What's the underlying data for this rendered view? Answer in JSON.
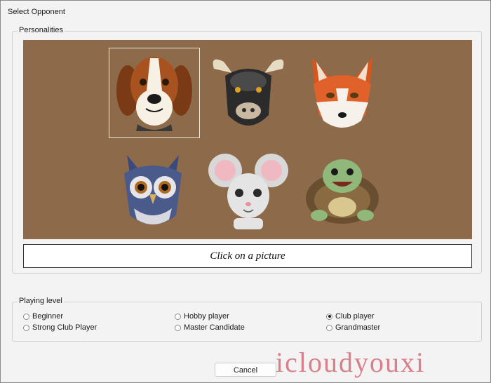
{
  "window": {
    "title": "Select Opponent"
  },
  "personalities": {
    "label": "Personalities",
    "selected": "beagle",
    "caption": "Click on a picture",
    "avatars": [
      {
        "name": "beagle",
        "icon": "dog-portrait"
      },
      {
        "name": "bull",
        "icon": "bull-portrait"
      },
      {
        "name": "fox",
        "icon": "fox-portrait"
      },
      {
        "name": "owl",
        "icon": "owl-portrait"
      },
      {
        "name": "mouse",
        "icon": "mouse-portrait"
      },
      {
        "name": "turtle",
        "icon": "turtle-portrait"
      }
    ]
  },
  "playing_level": {
    "label": "Playing level",
    "options": [
      "Beginner",
      "Hobby player",
      "Club player",
      "Strong Club Player",
      "Master Candidate",
      "Grandmaster"
    ],
    "selected": "Club player"
  },
  "buttons": {
    "cancel": "Cancel"
  },
  "watermark": "icloudyouxi",
  "colors": {
    "panel_background": "#8d6b4a",
    "window_background": "#f3f3f3",
    "watermark": "#d9808a"
  }
}
